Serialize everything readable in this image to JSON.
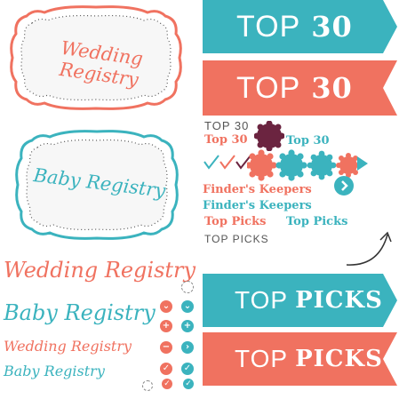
{
  "colors": {
    "coral": "#F07260",
    "teal": "#3BB3BE",
    "plum": "#6B2440",
    "gray": "#555555"
  },
  "labels": {
    "wedding_frame": "Wedding Registry",
    "baby_frame": "Baby Registry",
    "wedding_large": "Wedding Registry",
    "baby_large": "Baby Registry",
    "wedding_small": "Wedding Registry",
    "baby_small": "Baby Registry"
  },
  "banners": {
    "top30_teal": {
      "word": "TOP",
      "num": "30"
    },
    "top30_coral": {
      "word": "TOP",
      "num": "30"
    },
    "toppicks_teal": {
      "word": "TOP",
      "picks": "PICKS"
    },
    "toppicks_coral": {
      "word": "TOP",
      "picks": "PICKS"
    }
  },
  "middle": {
    "top30_gray": "TOP 30",
    "top30_coral": "Top 30",
    "top30_teal": "Top 30",
    "finders_coral": "Finder's Keepers",
    "finders_teal": "Finder's Keepers",
    "toppicks_coral": "Top Picks",
    "toppicks_teal": "Top Picks",
    "toppicks_gray": "TOP PICKS"
  },
  "icons": {
    "checks": [
      "check-teal",
      "check-coral",
      "check-plum"
    ],
    "badges": [
      "badge-coral",
      "badge-teal",
      "badge-teal-2",
      "badge-coral-2"
    ],
    "arrow_button": "chevron-right-icon",
    "button_grid": [
      "empty",
      "plus",
      "minus",
      "chevron",
      "checkmark"
    ]
  }
}
